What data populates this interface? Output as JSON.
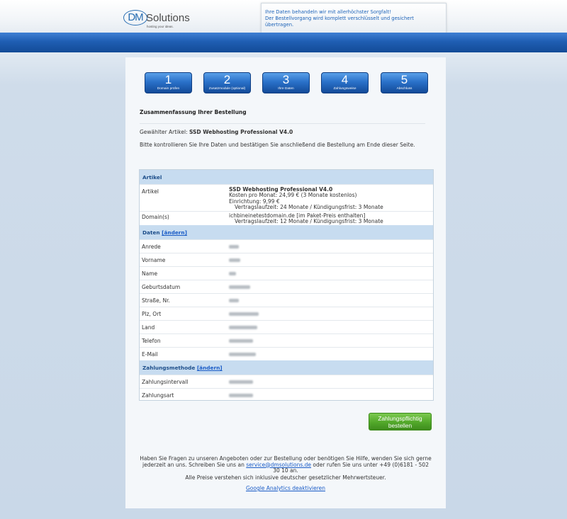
{
  "header": {
    "logo": {
      "dm": "DM",
      "solutions": "Solutions",
      "tagline": "hosting your ideas."
    },
    "notice_line1": "Ihre Daten behandeln wir mit allerhöchster Sorgfalt!",
    "notice_line2": "Der Bestellvorgang wird komplett verschlüsselt und gesichert übertragen."
  },
  "steps": [
    {
      "num": "1",
      "label": "Domain prüfen"
    },
    {
      "num": "2",
      "label": "Zusatzmodule (optional)"
    },
    {
      "num": "3",
      "label": "Ihre Daten"
    },
    {
      "num": "4",
      "label": "Zahlungsweise"
    },
    {
      "num": "5",
      "label": "Abschluss"
    }
  ],
  "summary": {
    "title": "Zusammenfassung Ihrer Bestellung",
    "article_prefix": "Gewählter Artikel:",
    "article_name": "SSD Webhosting Professional V4.0",
    "instruction": "Bitte kontrollieren Sie Ihre Daten und bestätigen Sie anschließend die Bestellung am Ende dieser Seite."
  },
  "table": {
    "article_section": "Artikel",
    "article_label": "Artikel",
    "article_value": {
      "name": "SSD Webhosting Professional V4.0",
      "cost": "Kosten pro Monat: 24,99 € (3 Monate kostenlos)",
      "setup": "Einrichtung: 9,99 €",
      "terms": "Vertragslaufzeit: 24 Monate / Kündigungsfrist: 3 Monate"
    },
    "domain_label": "Domain(s)",
    "domain_value": {
      "name": "ichbineinetestdomain.de [im Paket-Preis enthalten]",
      "terms": "Vertragslaufzeit: 12 Monate / Kündigungsfrist: 3 Monate"
    },
    "data_section": "Daten",
    "change_link": "[ändern]",
    "data_fields": [
      "Anrede",
      "Vorname",
      "Name",
      "Geburtsdatum",
      "Straße, Nr.",
      "Plz, Ort",
      "Land",
      "Telefon",
      "E-Mail"
    ],
    "payment_section": "Zahlungsmethode",
    "payment_fields": [
      "Zahlungsintervall",
      "Zahlungsart"
    ]
  },
  "order_button": {
    "line1": "Zahlungspflichtig",
    "line2": "bestellen"
  },
  "footer": {
    "help_text_1": "Haben Sie Fragen zu unseren Angeboten oder zur Bestellung oder benötigen Sie Hilfe, wenden Sie sich gerne jederzeit an uns. Schreiben Sie uns an",
    "help_email": "service@dmsolutions.de",
    "help_text_2": "oder rufen Sie uns unter +49 (0)6181 - 502 30 10 an.",
    "prices": "Alle Preise verstehen sich inklusive deutscher gesetzlicher Mehrwertsteuer.",
    "analytics_link": "Google Analytics deaktivieren"
  },
  "colors": {
    "accent_blue": "#1f5eb3",
    "order_green": "#52a82a",
    "link_blue": "#1a5cc7"
  }
}
